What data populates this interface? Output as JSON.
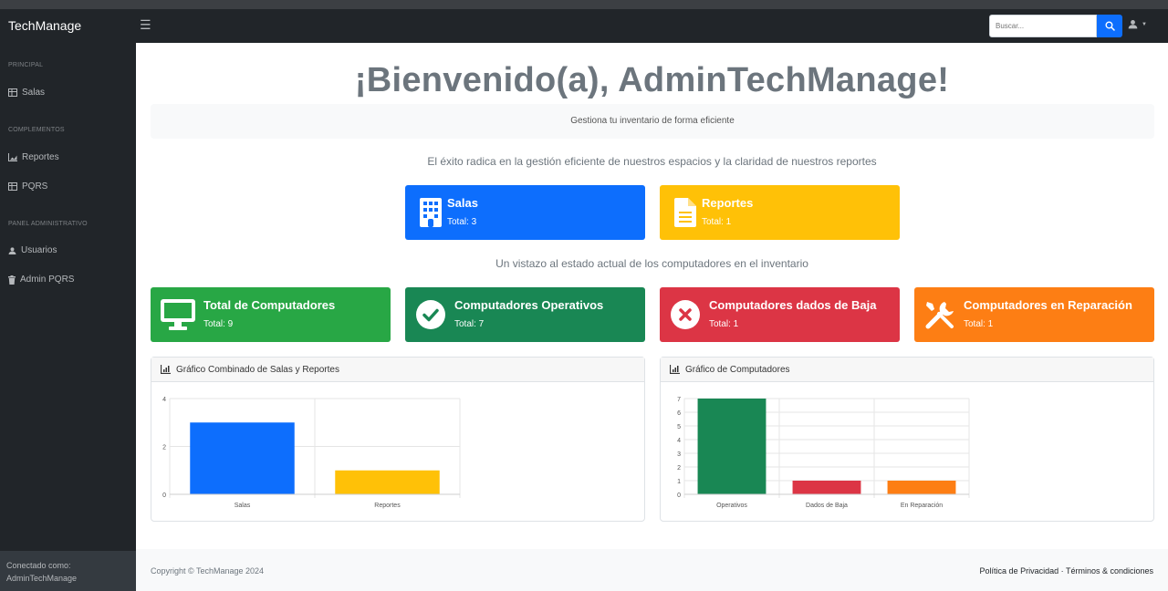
{
  "app": {
    "brand": "TechManage"
  },
  "search": {
    "placeholder": "Buscar..."
  },
  "sidebar": {
    "sections": [
      {
        "heading": "PRINCIPAL",
        "items": [
          {
            "label": "Salas",
            "icon": "table-icon"
          }
        ]
      },
      {
        "heading": "COMPLEMENTOS",
        "items": [
          {
            "label": "Reportes",
            "icon": "chart-area-icon"
          },
          {
            "label": "PQRS",
            "icon": "table-icon"
          }
        ]
      },
      {
        "heading": "PANEL ADMINISTRATIVO",
        "items": [
          {
            "label": "Usuarios",
            "icon": "user-icon"
          },
          {
            "label": "Admin PQRS",
            "icon": "trash-icon"
          }
        ]
      }
    ],
    "footer": {
      "label": "Conectado como:",
      "user": "AdminTechManage"
    }
  },
  "main": {
    "welcome": "¡Bienvenido(a), AdminTechManage!",
    "tagline": "Gestiona tu inventario de forma eficiente",
    "subtitle1": "El éxito radica en la gestión eficiente de nuestros espacios y la claridad de nuestros reportes",
    "subtitle2": "Un vistazo al estado actual de los computadores en el inventario",
    "top_cards": [
      {
        "title": "Salas",
        "total": "Total: 3",
        "color": "#0d6efd",
        "icon": "building-icon"
      },
      {
        "title": "Reportes",
        "total": "Total: 1",
        "color": "#ffc107",
        "icon": "file-icon"
      }
    ],
    "status_cards": [
      {
        "title": "Total de Computadores",
        "total": "Total: 9",
        "color": "#28a745",
        "icon": "desktop-icon"
      },
      {
        "title": "Computadores Operativos",
        "total": "Total: 7",
        "color": "#198754",
        "icon": "check-circle-icon"
      },
      {
        "title": "Computadores dados de Baja",
        "total": "Total: 1",
        "color": "#dc3545",
        "icon": "x-circle-icon"
      },
      {
        "title": "Computadores en Reparación",
        "total": "Total: 1",
        "color": "#fd7e14",
        "icon": "tools-icon"
      }
    ],
    "panels": [
      {
        "title": "Gráfico Combinado de Salas y Reportes"
      },
      {
        "title": "Gráfico de Computadores"
      }
    ]
  },
  "chart_data": [
    {
      "type": "bar",
      "title": "",
      "categories": [
        "Salas",
        "Reportes"
      ],
      "values": [
        3,
        1
      ],
      "colors": [
        "#0d6efd",
        "#ffc107"
      ],
      "ylim": [
        0,
        4
      ],
      "yticks": [
        0,
        2,
        4
      ],
      "grid": true
    },
    {
      "type": "bar",
      "title": "",
      "categories": [
        "Operativos",
        "Dados de Baja",
        "En Reparación"
      ],
      "values": [
        7,
        1,
        1
      ],
      "colors": [
        "#198754",
        "#dc3545",
        "#fd7e14"
      ],
      "ylim": [
        0,
        7
      ],
      "yticks": [
        0,
        1,
        2,
        3,
        4,
        5,
        6,
        7
      ],
      "grid": true
    }
  ],
  "footer": {
    "copyright": "Copyright © TechManage 2024",
    "privacy": "Política de Privacidad",
    "separator": "·",
    "terms": "Términos & condiciones"
  }
}
